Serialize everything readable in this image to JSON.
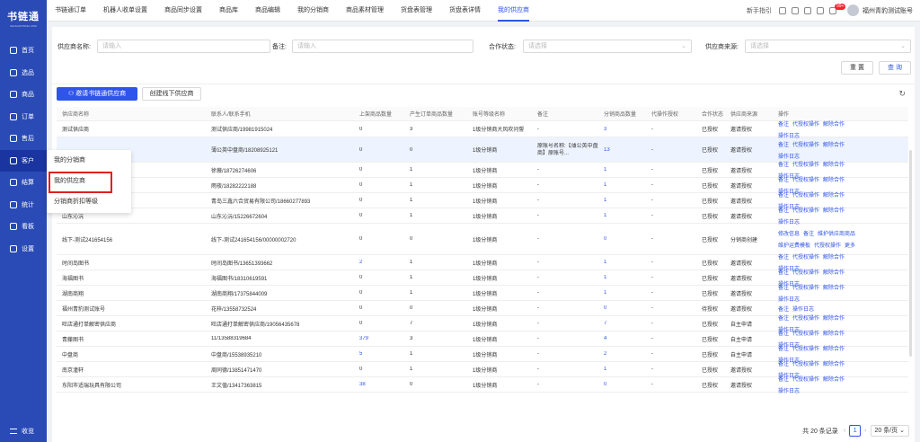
{
  "app": {
    "logo": "书链通",
    "logo_sub": "SHULIANTONG.COM"
  },
  "sidebar": {
    "items": [
      {
        "label": "首页"
      },
      {
        "label": "选品"
      },
      {
        "label": "商品"
      },
      {
        "label": "订单"
      },
      {
        "label": "售后"
      },
      {
        "label": "客户"
      },
      {
        "label": "结算"
      },
      {
        "label": "统计"
      },
      {
        "label": "看板"
      },
      {
        "label": "设置"
      }
    ],
    "footer": "收览"
  },
  "tabs": [
    "书链通订单",
    "机器人收单设置",
    "商品同步设置",
    "商品库",
    "商品编辑",
    "我的分销商",
    "商品素材管理",
    "货盘表管理",
    "货盘表详情",
    "我的供应商"
  ],
  "topbar": {
    "guide": "新手指引",
    "badge": "99+",
    "account": "福州青豹测试账号"
  },
  "filters": {
    "supplier_label": "供应商名称:",
    "supplier_ph": "请输入",
    "remark_label": "备注:",
    "remark_ph": "请输入",
    "status_label": "合作状态:",
    "status_ph": "请选择",
    "source_label": "供应商来源:",
    "source_ph": "请选择",
    "reset": "重 置",
    "query": "查 询"
  },
  "actions": {
    "invite": "邀请书链通供应商",
    "create": "创建线下供应商"
  },
  "columns": [
    "供应商名称",
    "联系人/联系手机",
    "上架商品数量",
    "产生订单商品数量",
    "账号等级名称",
    "备注",
    "分销商品数量",
    "代操作授权",
    "合作状态",
    "供应商来源",
    "操作"
  ],
  "rows": [
    {
      "name": "测试供应商",
      "contact": "测试供应商/19981915024",
      "up": "0",
      "orders": "3",
      "level": "1级分销商大风吹问誓",
      "remark": "-",
      "dist": "3",
      "proxy": "-",
      "status": "已授权",
      "src": "邀请授权",
      "ops": [
        "备注",
        "代授权操作",
        "解除合作",
        "操作日志"
      ]
    },
    {
      "name": "",
      "contact": "薄公英中盘商/18208925121",
      "up": "0",
      "orders": "0",
      "level": "1级分销商",
      "remark": "原账号名称:【薄公英中盘商】原账号...",
      "dist": "13",
      "proxy": "-",
      "status": "已授权",
      "src": "邀请授权",
      "ops": [
        "备注",
        "代授权操作",
        "解除合作",
        "操作日志"
      ]
    },
    {
      "name": "",
      "contact": "徐薇/18726274606",
      "up": "0",
      "orders": "1",
      "level": "1级分销商",
      "remark": "-",
      "dist": "1",
      "proxy": "-",
      "status": "已授权",
      "src": "邀请授权",
      "ops": [
        "备注",
        "代授权操作",
        "解除合作",
        "操作日志"
      ]
    },
    {
      "name": "",
      "contact": "雨夜/18282222188",
      "up": "0",
      "orders": "1",
      "level": "1级分销商",
      "remark": "-",
      "dist": "1",
      "proxy": "-",
      "status": "已授权",
      "src": "邀请授权",
      "ops": [
        "备注",
        "代授权操作",
        "解除合作",
        "操作日志"
      ]
    },
    {
      "name": "",
      "contact": "青岛三鑫六合贸易有限公司/18660277893",
      "up": "0",
      "orders": "1",
      "level": "1级分销商",
      "remark": "-",
      "dist": "1",
      "proxy": "-",
      "status": "已授权",
      "src": "邀请授权",
      "ops": [
        "备注",
        "代授权操作",
        "解除合作",
        "操作日志"
      ]
    },
    {
      "name": "山东沁沅",
      "contact": "山东沁沅/15226672604",
      "up": "0",
      "orders": "1",
      "level": "1级分销商",
      "remark": "-",
      "dist": "1",
      "proxy": "-",
      "status": "已授权",
      "src": "邀请授权",
      "ops": [
        "备注",
        "代授权操作",
        "解除合作",
        "操作日志"
      ]
    },
    {
      "name": "线下-测试241654156",
      "contact": "线下-测试241654156/00000002720",
      "up": "0",
      "orders": "0",
      "level": "1级分销商",
      "remark": "-",
      "dist": "0",
      "proxy": "-",
      "status": "已授权",
      "src": "分销商创建",
      "ops": [
        "修改信息",
        "备注",
        "维护供应商商品",
        "维护运费模板",
        "代授权操作",
        "更多"
      ]
    },
    {
      "name": "时间岛图书",
      "contact": "时间岛图书/13651393662",
      "up": "2",
      "orders": "1",
      "level": "1级分销商",
      "remark": "-",
      "dist": "1",
      "proxy": "-",
      "status": "已授权",
      "src": "邀请授权",
      "ops": [
        "备注",
        "代授权操作",
        "解除合作",
        "操作日志"
      ]
    },
    {
      "name": "海福图书",
      "contact": "海福图书/18310619591",
      "up": "0",
      "orders": "1",
      "level": "1级分销商",
      "remark": "-",
      "dist": "1",
      "proxy": "-",
      "status": "已授权",
      "src": "邀请授权",
      "ops": [
        "备注",
        "代授权操作",
        "解除合作",
        "操作日志"
      ]
    },
    {
      "name": "湖南商翔",
      "contact": "湖南商翔/17375844009",
      "up": "0",
      "orders": "1",
      "level": "1级分销商",
      "remark": "-",
      "dist": "1",
      "proxy": "-",
      "status": "已授权",
      "src": "邀请授权",
      "ops": [
        "备注",
        "代授权操作",
        "解除合作",
        "操作日志"
      ]
    },
    {
      "name": "福州青豹测试账号",
      "contact": "花梓/13558732524",
      "up": "0",
      "orders": "0",
      "level": "1级分销商",
      "remark": "-",
      "dist": "0",
      "proxy": "-",
      "status": "待授权",
      "src": "邀请授权",
      "ops": [
        "备注",
        "操作日志"
      ]
    },
    {
      "name": "旺店通打单解密供应商",
      "contact": "旺店通打单解密供应商/19056435678",
      "up": "0",
      "orders": "7",
      "level": "1级分销商",
      "remark": "-",
      "dist": "7",
      "proxy": "-",
      "status": "已授权",
      "src": "自主申请",
      "ops": [
        "备注",
        "代授权操作",
        "解除合作",
        "操作日志"
      ]
    },
    {
      "name": "青藤图书",
      "contact": "11/13588319684",
      "up": "379",
      "orders": "3",
      "level": "1级分销商",
      "remark": "-",
      "dist": "4",
      "proxy": "-",
      "status": "已授权",
      "src": "自主申请",
      "ops": [
        "备注",
        "代授权操作",
        "解除合作",
        "操作日志"
      ]
    },
    {
      "name": "中盘商",
      "contact": "中盘商/15538935210",
      "up": "5",
      "orders": "1",
      "level": "1级分销商",
      "remark": "-",
      "dist": "2",
      "proxy": "-",
      "status": "已授权",
      "src": "自主申请",
      "ops": [
        "备注",
        "代授权操作",
        "解除合作",
        "操作日志"
      ]
    },
    {
      "name": "南京潼轩",
      "contact": "周同德/13851471470",
      "up": "0",
      "orders": "1",
      "level": "1级分销商",
      "remark": "-",
      "dist": "1",
      "proxy": "-",
      "status": "已授权",
      "src": "邀请授权",
      "ops": [
        "备注",
        "代授权操作",
        "解除合作",
        "操作日志"
      ]
    },
    {
      "name": "东阳市适瑞玩具有限公司",
      "contact": "王文值/13417363815",
      "up": "38",
      "orders": "0",
      "level": "1级分销商",
      "remark": "-",
      "dist": "0",
      "proxy": "-",
      "status": "已授权",
      "src": "邀请授权",
      "ops": [
        "备注",
        "代授权操作",
        "解除合作",
        "操作日志"
      ]
    }
  ],
  "pager": {
    "total": "共 20 条记录",
    "page": "1",
    "size": "20 条/页"
  },
  "dropdown": [
    "我的分销商",
    "我的供应商",
    "分销商折扣等级"
  ],
  "colors": {
    "brand": "#2a4ab5",
    "accent": "#2f54eb",
    "highlight": "#e02020"
  }
}
